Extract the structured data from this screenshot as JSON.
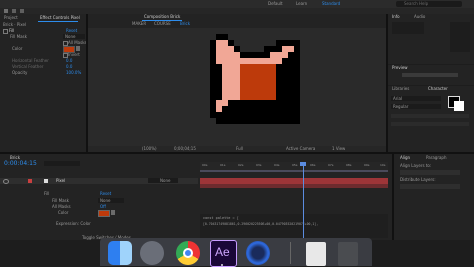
{
  "menubar": {
    "items": [
      "Default",
      "Learn",
      "Standard"
    ],
    "search_placeholder": "Search Help"
  },
  "left_panel": {
    "tab_project": "Project",
    "tab_effect_controls": "Effect Controls Pixel",
    "breadcrumb": "Brick · Pixel",
    "effect_name": "Fill",
    "reset": "Reset",
    "rows": [
      {
        "label": "Fill Mask",
        "value": "None"
      },
      {
        "label": "",
        "value": "All Masks"
      },
      {
        "label": "Color",
        "value": ""
      },
      {
        "label": "",
        "value": "Invert"
      },
      {
        "label": "Horizontal Feather",
        "value": "0.0"
      },
      {
        "label": "Vertical Feather",
        "value": "0.0"
      },
      {
        "label": "Opacity",
        "value": "100.0%"
      }
    ]
  },
  "composition": {
    "tab": "Composition Brick",
    "nav": [
      "MAKER",
      "COURSE",
      "Brick"
    ],
    "zoom": "(100%)",
    "timecode": "0;00;04;15",
    "quality": "Full",
    "camera": "Active Camera",
    "view": "1 View"
  },
  "right_panel": {
    "info": "Info",
    "audio": "Audio",
    "libraries": "Libraries",
    "preview": "Preview",
    "character": "Character",
    "font": "Arial",
    "style": "Regular",
    "align": "Align",
    "paragraph": "Paragraph",
    "align_layers_to": "Align Layers to:",
    "distribute_layers": "Distribute Layers:"
  },
  "timeline": {
    "tab": "Brick",
    "timecode": "0:00:04:15",
    "layer_name": "Pixel",
    "mode": "None",
    "effect_fill": "Fill",
    "reset": "Reset",
    "fill_mask": "Fill Mask",
    "fill_mask_value": "None",
    "all_masks": "All Masks",
    "all_masks_value": "Off",
    "color": "Color",
    "expression": "Expression: Color",
    "toggle": "Toggle Switches / Modes",
    "ruler": [
      "00s",
      "01s",
      "02s",
      "03s",
      "04s",
      "05s",
      "06s",
      "07s",
      "08s",
      "09s",
      "10s"
    ],
    "code_lines": [
      "const palette = [",
      "  [0.70431749081861,0.29602022550E+00,0.04790352021907E+00,1],"
    ]
  },
  "colors": {
    "accent_blue": "#2d8ceb",
    "playhead": "#5b8ce0",
    "pixel_light": "#f1a796",
    "pixel_dark": "#bd3a0b",
    "pixel_black": "#000000",
    "layer_bar": "#9d3538"
  },
  "pixel_art": [
    "................",
    "..##............",
    ".#LL#.......####",
    ".#LLL#....###LL#",
    ".#LLLL#####LLLK#",
    ".#LLLLLLLLLLLK##",
    ".##LLLOOOOOOK###",
    ".##LLLOOOOOOK###",
    ".##LLLOOOOOOK###",
    ".##LLLOOOOOOK###",
    ".##LLLOOOOOOK###",
    ".##LLLOOOOOOK###",
    ".#LLKKKKKKKKKKK#",
    ".#LKKKKKKKKKKKK#",
    ".#KKKKKKKKKKKKK#",
    "..##############"
  ]
}
